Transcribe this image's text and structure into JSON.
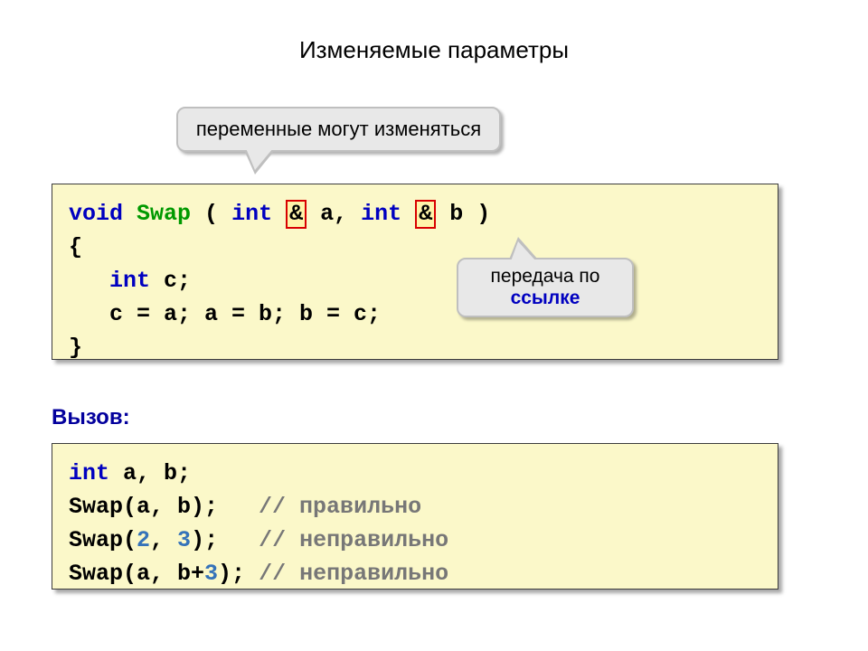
{
  "title": "Изменяемые параметры",
  "callout_top": "переменные могут изменяться",
  "callout_right_l1": "передача по",
  "callout_right_l2": "ссылке",
  "sub_heading": "Вызов:",
  "code1": {
    "void": "void",
    "swap": "Swap",
    "int1": "int",
    "amp1": "&",
    "a_decl": "a,",
    "int2": "int",
    "amp2": "&",
    "b_decl": "b )",
    "lbrace": "{",
    "int_c": "int",
    "c_decl": "c;",
    "body": "c = a; a = b; b = c;",
    "rbrace": "}"
  },
  "code2": {
    "int": "int",
    "decl": "a, b;",
    "call1a": "Swap(a, b);",
    "call1c": "// правильно",
    "call2a": "Swap(",
    "call2n1": "2",
    "call2m": ", ",
    "call2n2": "3",
    "call2b": ");",
    "call2c": "// неправильно",
    "call3a": "Swap(a, b+",
    "call3n": "3",
    "call3b": ");",
    "call3c": "// неправильно"
  }
}
